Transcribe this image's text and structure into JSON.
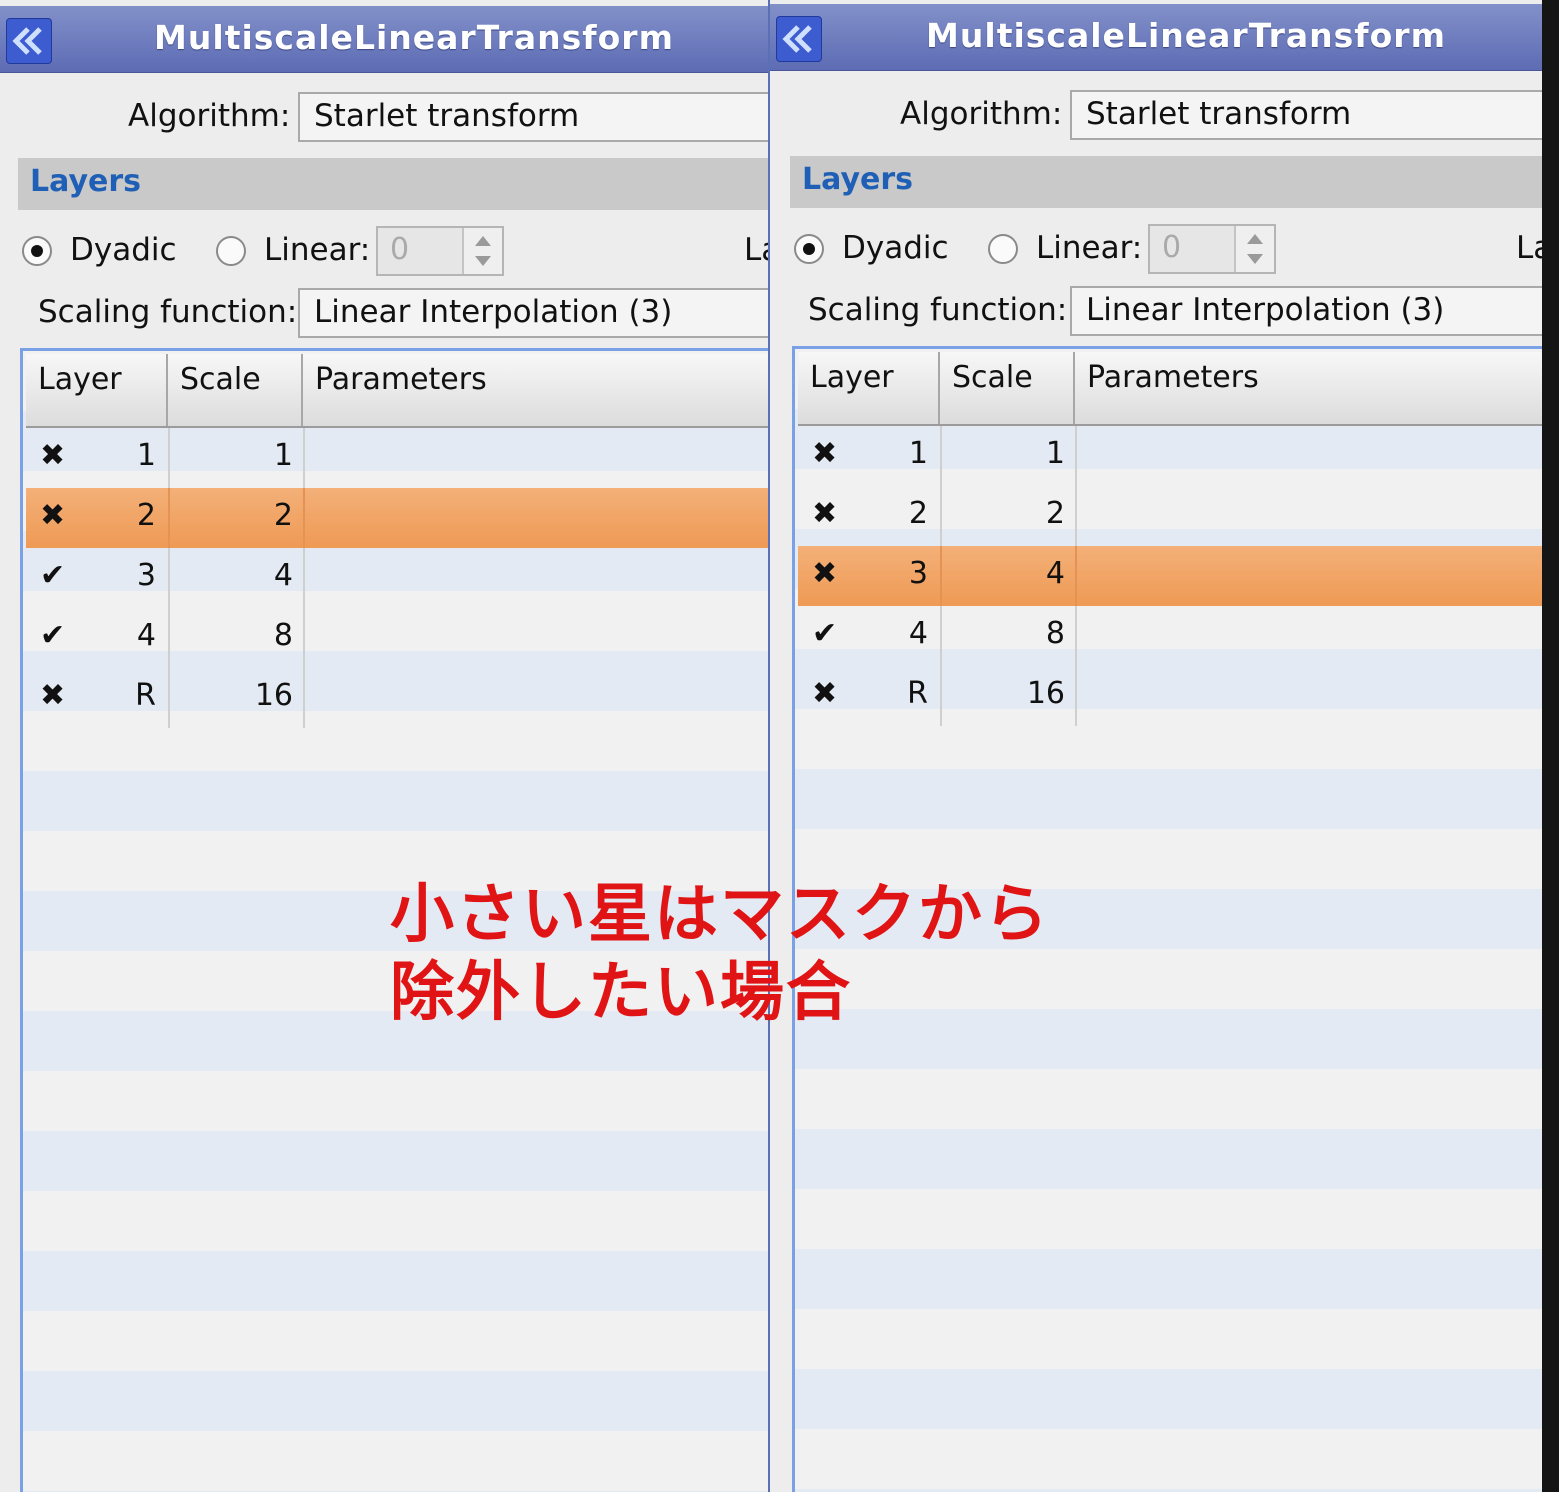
{
  "overlay": {
    "line1": "小さい星はマスクから",
    "line2": "除外したい場合"
  },
  "left": {
    "title": "MultiscaleLinearTransform",
    "algorithm_label": "Algorithm:",
    "algorithm_value": "Starlet transform",
    "section_label": "Layers",
    "dyadic_label": "Dyadic",
    "linear_label": "Linear:",
    "linear_value": "0",
    "cutoff_label": "La",
    "scaling_label": "Scaling function:",
    "scaling_value": "Linear Interpolation (3)",
    "columns": [
      "Layer",
      "Scale",
      "Parameters"
    ],
    "rows": [
      {
        "state": "disabled",
        "icon": "✖",
        "layer": "1",
        "scale": "1",
        "selected": false
      },
      {
        "state": "disabled",
        "icon": "✖",
        "layer": "2",
        "scale": "2",
        "selected": true
      },
      {
        "state": "enabled",
        "icon": "✔",
        "layer": "3",
        "scale": "4",
        "selected": false
      },
      {
        "state": "enabled",
        "icon": "✔",
        "layer": "4",
        "scale": "8",
        "selected": false
      },
      {
        "state": "disabled",
        "icon": "✖",
        "layer": "R",
        "scale": "16",
        "selected": false
      }
    ]
  },
  "right": {
    "title": "MultiscaleLinearTransform",
    "algorithm_label": "Algorithm:",
    "algorithm_value": "Starlet transform",
    "section_label": "Layers",
    "dyadic_label": "Dyadic",
    "linear_label": "Linear:",
    "linear_value": "0",
    "cutoff_label": "La",
    "scaling_label": "Scaling function:",
    "scaling_value": "Linear Interpolation (3)",
    "columns": [
      "Layer",
      "Scale",
      "Parameters"
    ],
    "rows": [
      {
        "state": "disabled",
        "icon": "✖",
        "layer": "1",
        "scale": "1",
        "selected": false
      },
      {
        "state": "disabled",
        "icon": "✖",
        "layer": "2",
        "scale": "2",
        "selected": false
      },
      {
        "state": "disabled",
        "icon": "✖",
        "layer": "3",
        "scale": "4",
        "selected": true
      },
      {
        "state": "enabled",
        "icon": "✔",
        "layer": "4",
        "scale": "8",
        "selected": false
      },
      {
        "state": "disabled",
        "icon": "✖",
        "layer": "R",
        "scale": "16",
        "selected": false
      }
    ]
  }
}
